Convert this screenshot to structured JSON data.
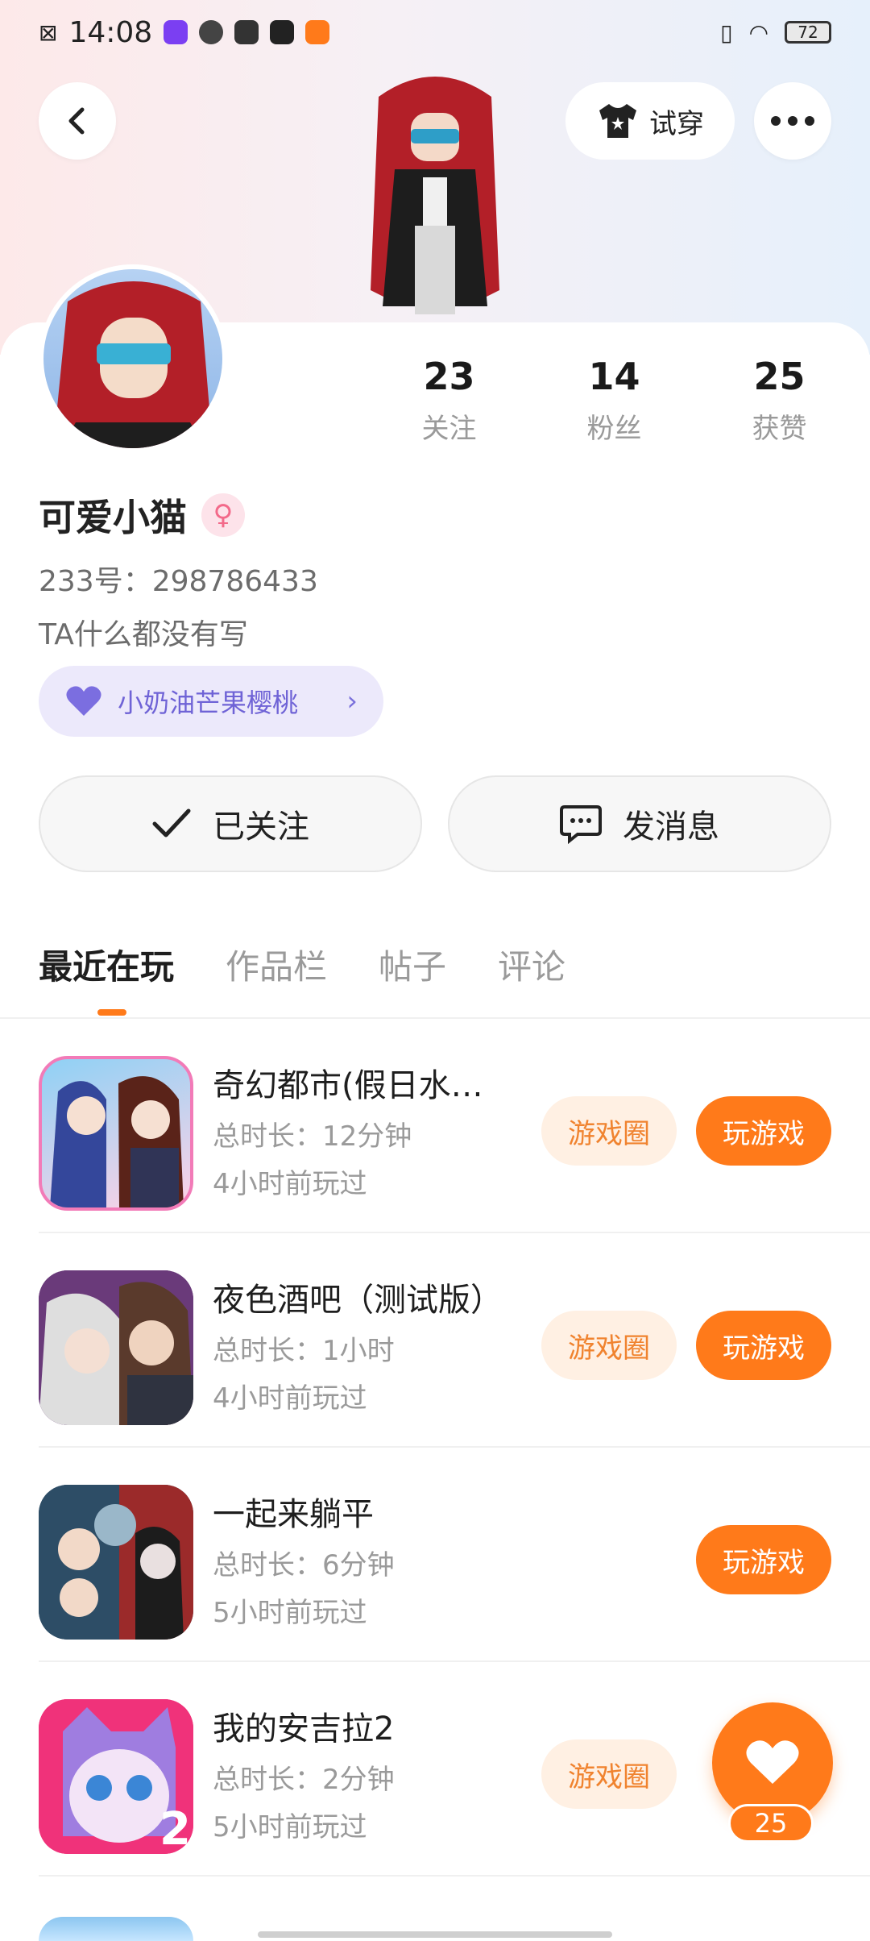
{
  "status_bar": {
    "time": "14:08",
    "battery": "72"
  },
  "header": {
    "try_on_label": "试穿"
  },
  "profile": {
    "stats": [
      {
        "value": "23",
        "label": "关注"
      },
      {
        "value": "14",
        "label": "粉丝"
      },
      {
        "value": "25",
        "label": "获赞"
      }
    ],
    "name": "可爱小猫",
    "uid": "233号：298786433",
    "bio": "TA什么都没有写",
    "club": "小奶油芒果樱桃"
  },
  "actions": {
    "followed_label": "已关注",
    "message_label": "发消息"
  },
  "tabs": [
    {
      "label": "最近在玩",
      "active": true
    },
    {
      "label": "作品栏",
      "active": false
    },
    {
      "label": "帖子",
      "active": false
    },
    {
      "label": "评论",
      "active": false
    }
  ],
  "games": [
    {
      "title": "奇幻都市(假日水…",
      "duration": "总时长：12分钟",
      "last_played": "4小时前玩过",
      "circle_label": "游戏圈",
      "play_label": "玩游戏"
    },
    {
      "title": "夜色酒吧（测试版）",
      "duration": "总时长：1小时",
      "last_played": "4小时前玩过",
      "circle_label": "游戏圈",
      "play_label": "玩游戏"
    },
    {
      "title": "一起来躺平",
      "duration": "总时长：6分钟",
      "last_played": "5小时前玩过",
      "circle_label": "",
      "play_label": "玩游戏"
    },
    {
      "title": "我的安吉拉2",
      "duration": "总时长：2分钟",
      "last_played": "5小时前玩过",
      "circle_label": "游戏圈",
      "play_label": ""
    }
  ],
  "fab": {
    "likes": "25"
  },
  "colors": {
    "accent": "#ff7a1a",
    "accent_soft": "#fff0e3",
    "club_bg": "#ece9fb"
  },
  "icons": {
    "back": "back-arrow-icon",
    "more": "more-icon",
    "shirt": "shirt-icon",
    "heart": "heart-icon",
    "check": "check-icon",
    "message": "message-icon"
  }
}
